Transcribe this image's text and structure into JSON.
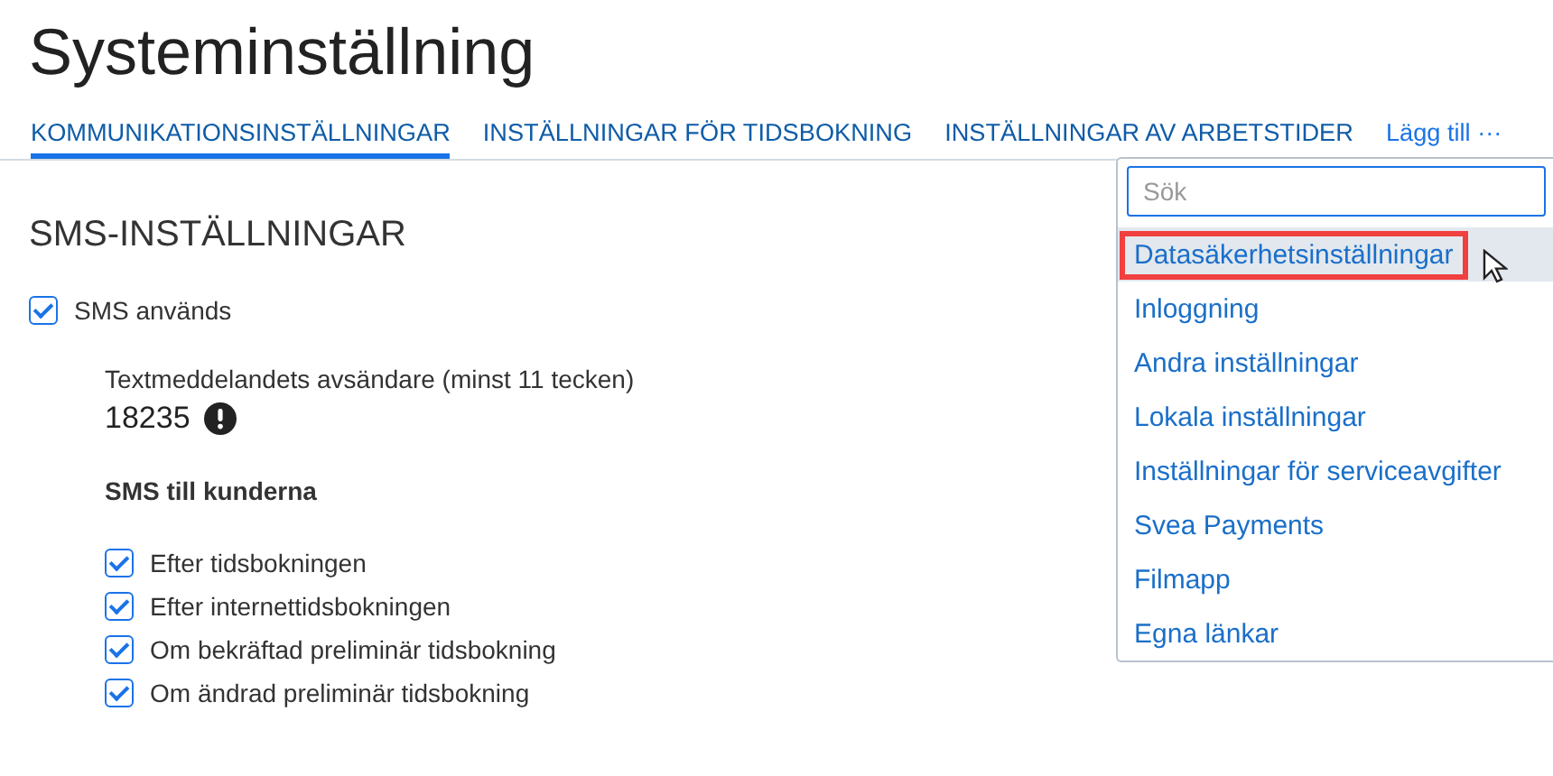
{
  "title": "Systeminställning",
  "tabs": [
    {
      "label": "KOMMUNIKATIONSINSTÄLLNINGAR",
      "selected": true
    },
    {
      "label": "INSTÄLLNINGAR FÖR TIDSBOKNING",
      "selected": false
    },
    {
      "label": "INSTÄLLNINGAR AV ARBETSTIDER",
      "selected": false
    }
  ],
  "more_link": "Lägg till ···",
  "section": {
    "heading": "SMS-INSTÄLLNINGAR",
    "enabled": {
      "label": "SMS används",
      "checked": true
    },
    "sender_label": "Textmeddelandets avsändare (minst 11 tecken)",
    "sender_value": "18235",
    "sender_warning": true,
    "customers_heading": "SMS till kunderna",
    "options": [
      {
        "label": "Efter tidsbokningen",
        "checked": true
      },
      {
        "label": "Efter internettidsbokningen",
        "checked": true
      },
      {
        "label": "Om bekräftad preliminär tidsbokning",
        "checked": true
      },
      {
        "label": "Om ändrad preliminär tidsbokning",
        "checked": true
      }
    ]
  },
  "dropdown": {
    "search": {
      "placeholder": "Sök"
    },
    "items": [
      {
        "label": "Datasäkerhetsinställningar",
        "selected": true
      },
      {
        "label": "Inloggning",
        "selected": false
      },
      {
        "label": "Andra inställningar",
        "selected": false
      },
      {
        "label": "Lokala inställningar",
        "selected": false
      },
      {
        "label": "Inställningar för serviceavgifter",
        "selected": false
      },
      {
        "label": "Svea Payments",
        "selected": false
      },
      {
        "label": "Filmapp",
        "selected": false
      },
      {
        "label": "Egna länkar",
        "selected": false
      }
    ]
  }
}
